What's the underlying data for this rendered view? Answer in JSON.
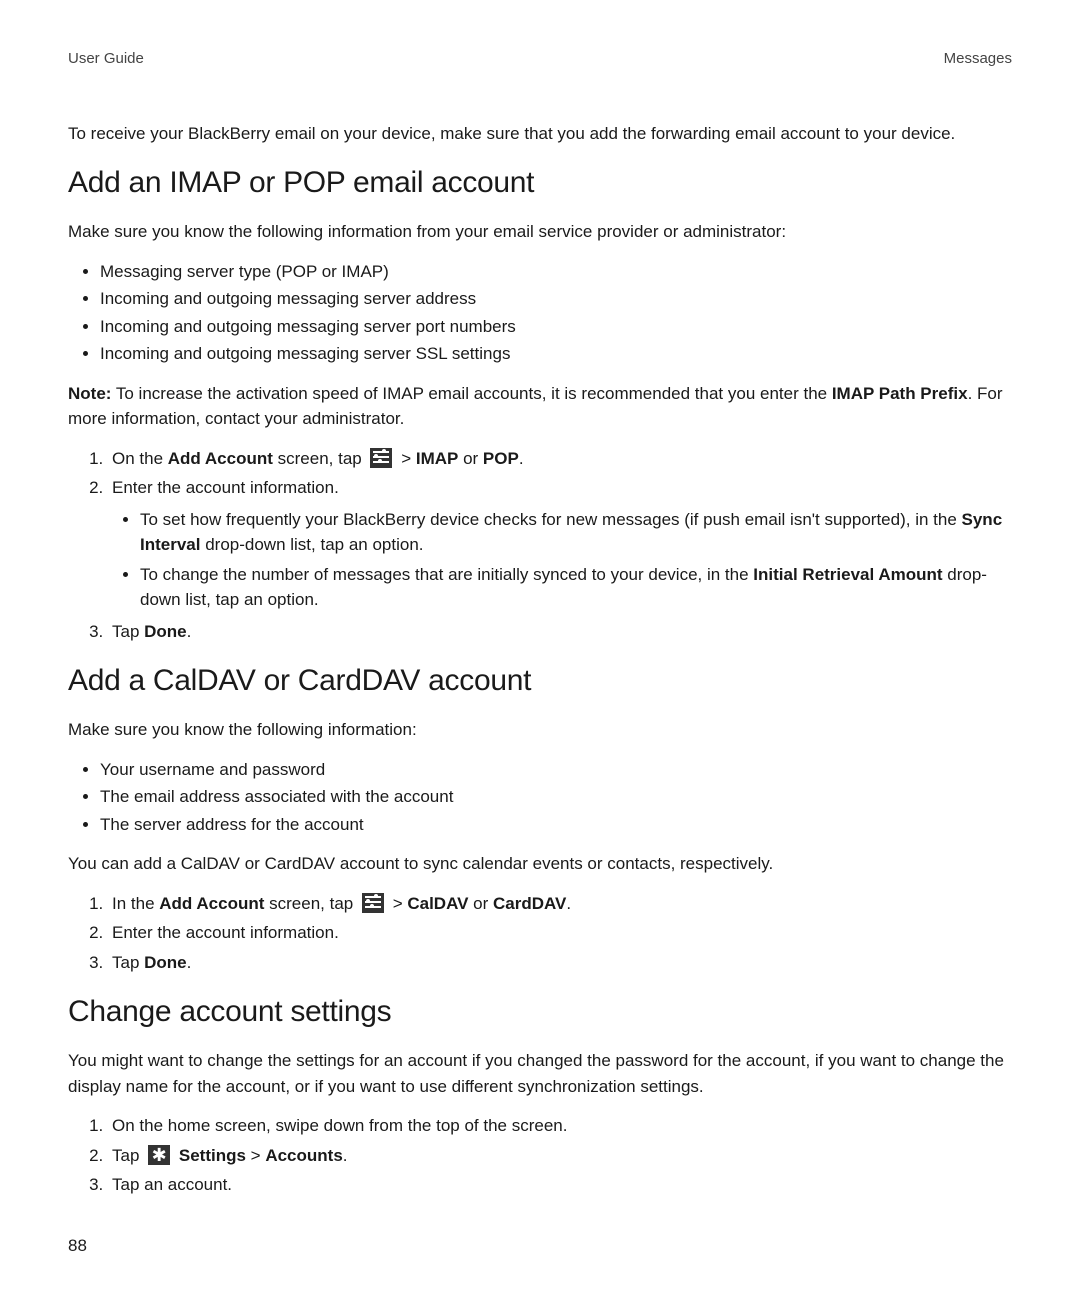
{
  "header": {
    "left": "User Guide",
    "right": "Messages"
  },
  "intro": "To receive your BlackBerry email on your device, make sure that you add the forwarding email account to your device.",
  "section1": {
    "title": "Add an IMAP or POP email account",
    "lead": "Make sure you know the following information from your email service provider or administrator:",
    "bullets": [
      "Messaging server type (POP or IMAP)",
      "Incoming and outgoing messaging server address",
      "Incoming and outgoing messaging server port numbers",
      "Incoming and outgoing messaging server SSL settings"
    ],
    "note": {
      "label": "Note:",
      "text1": " To increase the activation speed of IMAP email accounts, it is recommended that you enter the ",
      "bold1": "IMAP Path Prefix",
      "text2": ". For more information, contact your administrator."
    },
    "steps": {
      "s1": {
        "t1": "On the ",
        "b1": "Add Account",
        "t2": " screen, tap ",
        "t3": " > ",
        "b2": "IMAP",
        "t4": " or ",
        "b3": "POP",
        "t5": "."
      },
      "s2": "Enter the account information.",
      "sub": {
        "a": {
          "t1": "To set how frequently your BlackBerry device checks for new messages (if push email isn't supported), in the ",
          "b1": "Sync Interval",
          "t2": " drop-down list, tap an option."
        },
        "b": {
          "t1": "To change the number of messages that are initially synced to your device, in the ",
          "b1": "Initial Retrieval Amount",
          "t2": " drop-down list, tap an option."
        }
      },
      "s3": {
        "t1": "Tap ",
        "b1": "Done",
        "t2": "."
      }
    }
  },
  "section2": {
    "title": "Add a CalDAV or CardDAV account",
    "lead": "Make sure you know the following information:",
    "bullets": [
      "Your username and password",
      "The email address associated with the account",
      "The server address for the account"
    ],
    "para": "You can add a CalDAV or CardDAV account to sync calendar events or contacts, respectively.",
    "steps": {
      "s1": {
        "t1": "In the ",
        "b1": "Add Account",
        "t2": " screen, tap ",
        "t3": " > ",
        "b2": "CalDAV",
        "t4": " or ",
        "b3": "CardDAV",
        "t5": "."
      },
      "s2": "Enter the account information.",
      "s3": {
        "t1": "Tap ",
        "b1": "Done",
        "t2": "."
      }
    }
  },
  "section3": {
    "title": "Change account settings",
    "para": "You might want to change the settings for an account if you changed the password for the account, if you want to change the display name for the account, or if you want to use different synchronization settings.",
    "steps": {
      "s1": "On the home screen, swipe down from the top of the screen.",
      "s2": {
        "t1": "Tap ",
        "b1": "Settings",
        "t2": " > ",
        "b2": "Accounts",
        "t3": "."
      },
      "s3": "Tap an account."
    }
  },
  "page_number": "88"
}
